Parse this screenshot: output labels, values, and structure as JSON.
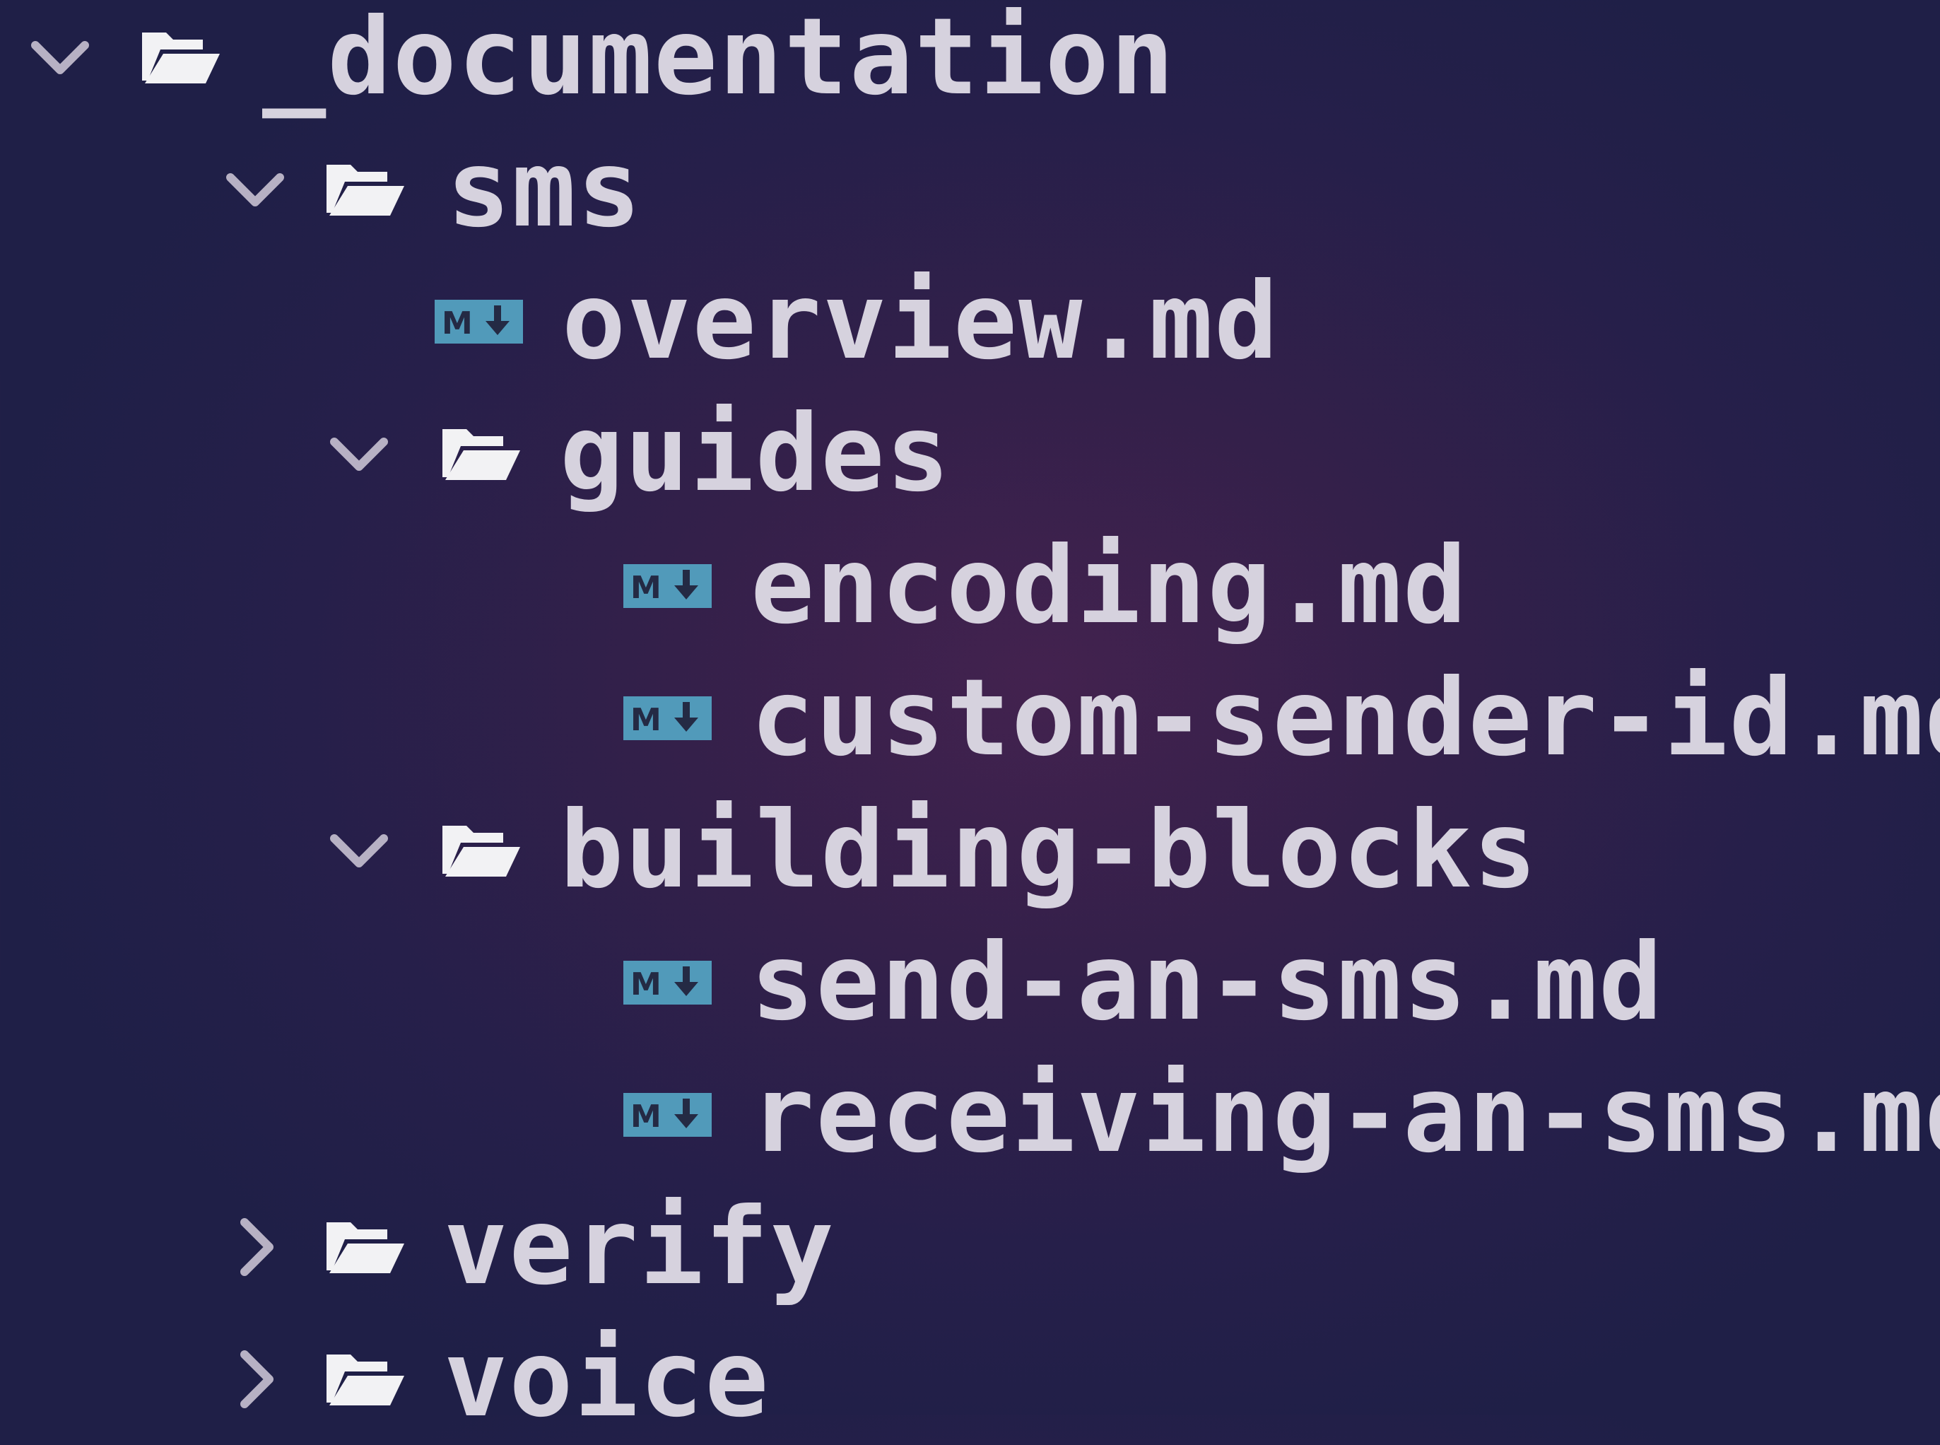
{
  "explorer": {
    "root": {
      "label": "_documentation",
      "expanded": true,
      "icon": "folder-open-icon",
      "chevron": "chevron-down-icon"
    },
    "items": [
      {
        "label": "sms",
        "type": "folder",
        "expanded": true,
        "icon": "folder-open-icon",
        "chevron": "chevron-down-icon"
      },
      {
        "label": "overview.md",
        "type": "file",
        "icon": "markdown-file-icon"
      },
      {
        "label": "guides",
        "type": "folder",
        "expanded": true,
        "icon": "folder-open-icon",
        "chevron": "chevron-down-icon"
      },
      {
        "label": "encoding.md",
        "type": "file",
        "icon": "markdown-file-icon"
      },
      {
        "label": "custom-sender-id.md",
        "type": "file",
        "icon": "markdown-file-icon"
      },
      {
        "label": "building-blocks",
        "type": "folder",
        "expanded": true,
        "icon": "folder-open-icon",
        "chevron": "chevron-down-icon"
      },
      {
        "label": "send-an-sms.md",
        "type": "file",
        "icon": "markdown-file-icon"
      },
      {
        "label": "receiving-an-sms.md",
        "type": "file",
        "icon": "markdown-file-icon"
      },
      {
        "label": "verify",
        "type": "folder",
        "expanded": false,
        "icon": "folder-open-icon",
        "chevron": "chevron-right-icon"
      },
      {
        "label": "voice",
        "type": "folder",
        "expanded": false,
        "icon": "folder-open-icon",
        "chevron": "chevron-right-icon"
      }
    ]
  },
  "colors": {
    "background_edge": "#1f1f47",
    "background_center": "#43224f",
    "text": "#d6d2de",
    "chevron": "#b7b1c4",
    "folder_icon": "#f2f2f4",
    "markdown_icon": "#519aba"
  }
}
